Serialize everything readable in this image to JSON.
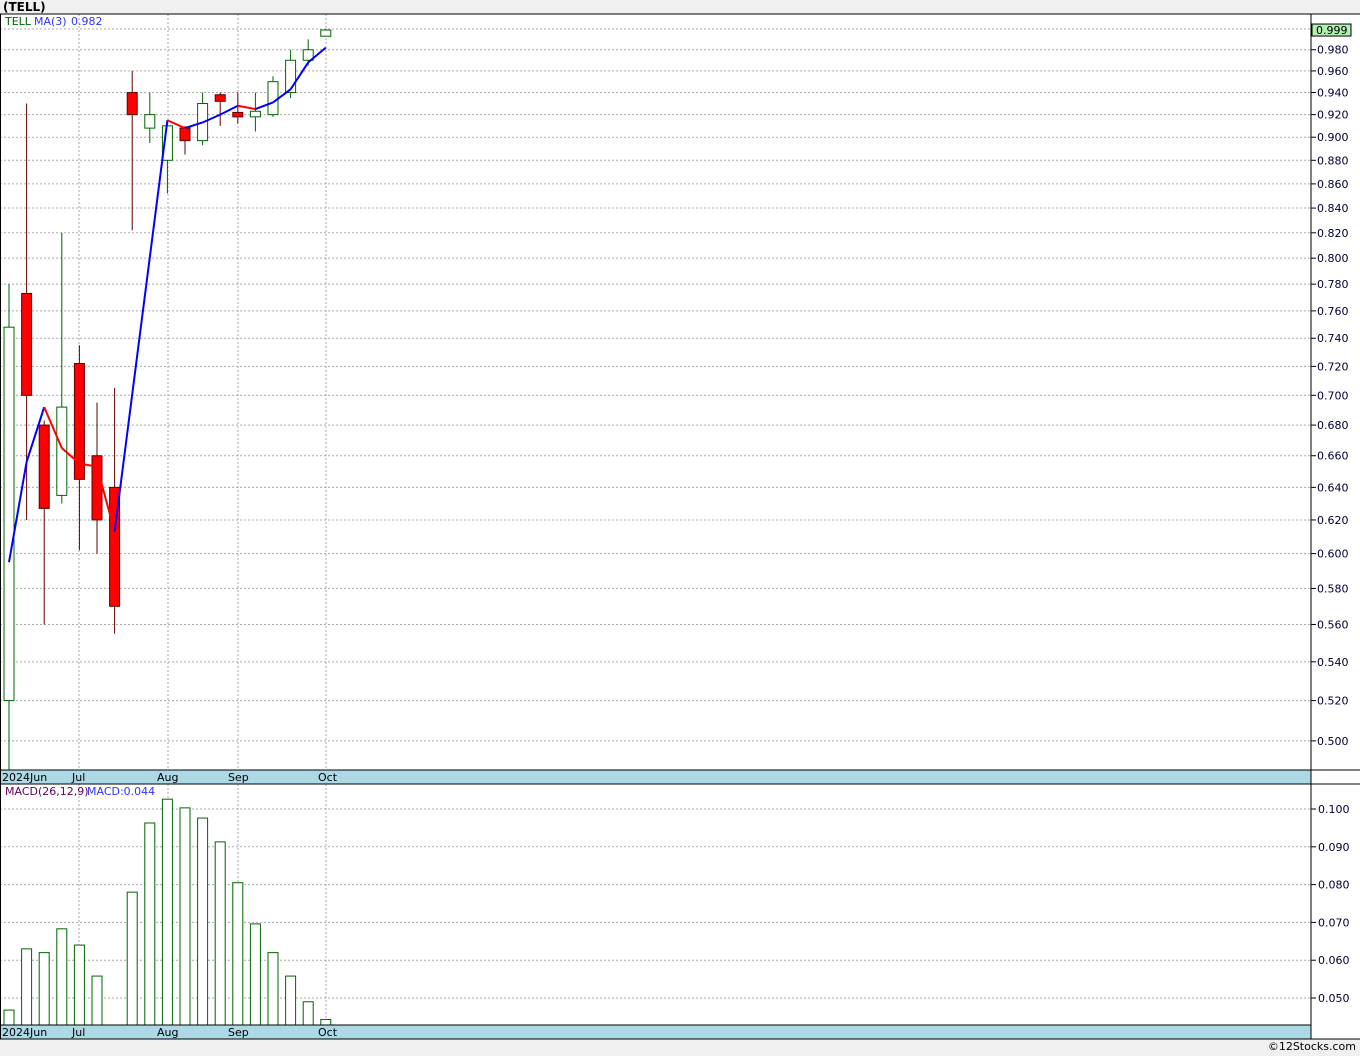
{
  "title": "(TELL)",
  "footer": "©12Stocks.com",
  "colors": {
    "up": "#006400",
    "down": "#ff0000",
    "down_wick": "#600000",
    "ma_up": "#0000ff",
    "ma_down": "#ff0000",
    "axis_bar": "#add8e6",
    "last_price_bg": "#b0f0b0"
  },
  "chart_data": [
    {
      "type": "candlestick",
      "legend": {
        "symbol": "TELL",
        "ma_label": "MA(3)",
        "ma_value": "0.982"
      },
      "y_scale": "log",
      "ylim": [
        0.48,
        1.0
      ],
      "y_ticks": [
        "1.000",
        "0.980",
        "0.960",
        "0.940",
        "0.920",
        "0.900",
        "0.880",
        "0.860",
        "0.840",
        "0.820",
        "0.800",
        "0.780",
        "0.760",
        "0.740",
        "0.720",
        "0.700",
        "0.680",
        "0.660",
        "0.640",
        "0.620",
        "0.600",
        "0.580",
        "0.560",
        "0.540",
        "0.520",
        "0.500"
      ],
      "last_price": "0.999",
      "x_ticks": [
        "2024Jun",
        "Jul",
        "Aug",
        "Sep",
        "Oct"
      ],
      "grid": true,
      "candles": [
        {
          "o": 0.52,
          "h": 0.78,
          "l": 0.48,
          "c": 0.748
        },
        {
          "o": 0.773,
          "h": 0.93,
          "l": 0.62,
          "c": 0.7
        },
        {
          "o": 0.68,
          "h": 0.683,
          "l": 0.56,
          "c": 0.627
        },
        {
          "o": 0.635,
          "h": 0.82,
          "l": 0.63,
          "c": 0.692
        },
        {
          "o": 0.722,
          "h": 0.735,
          "l": 0.602,
          "c": 0.645
        },
        {
          "o": 0.66,
          "h": 0.695,
          "l": 0.6,
          "c": 0.62
        },
        {
          "o": 0.64,
          "h": 0.705,
          "l": 0.555,
          "c": 0.57
        },
        {
          "o": 0.94,
          "h": 0.96,
          "l": 0.822,
          "c": 0.92
        },
        {
          "o": 0.908,
          "h": 0.94,
          "l": 0.895,
          "c": 0.92
        },
        {
          "o": 0.88,
          "h": 0.915,
          "l": 0.852,
          "c": 0.91
        },
        {
          "o": 0.908,
          "h": 0.91,
          "l": 0.885,
          "c": 0.897
        },
        {
          "o": 0.897,
          "h": 0.94,
          "l": 0.893,
          "c": 0.93
        },
        {
          "o": 0.938,
          "h": 0.94,
          "l": 0.91,
          "c": 0.932
        },
        {
          "o": 0.922,
          "h": 0.94,
          "l": 0.912,
          "c": 0.918
        },
        {
          "o": 0.918,
          "h": 0.94,
          "l": 0.905,
          "c": 0.923
        },
        {
          "o": 0.92,
          "h": 0.955,
          "l": 0.918,
          "c": 0.95
        },
        {
          "o": 0.94,
          "h": 0.98,
          "l": 0.935,
          "c": 0.97
        },
        {
          "o": 0.97,
          "h": 0.99,
          "l": 0.965,
          "c": 0.98
        },
        {
          "o": 0.993,
          "h": 1.0,
          "l": 0.993,
          "c": 0.999
        }
      ],
      "ma3": [
        0.595,
        0.656,
        0.692,
        0.665,
        0.655,
        0.653,
        0.613,
        null,
        null,
        0.915,
        0.908,
        0.913,
        0.92,
        0.928,
        0.925,
        0.931,
        0.943,
        0.968,
        0.982
      ]
    },
    {
      "type": "bar",
      "legend": {
        "label": "MACD(26,12,9)",
        "value": "MACD:0.044"
      },
      "ylim": [
        0.0429,
        0.1075
      ],
      "y_ticks": [
        "0.100",
        "0.090",
        "0.080",
        "0.070",
        "0.060",
        "0.050"
      ],
      "x_ticks": [
        "2024Jun",
        "Jul",
        "Aug",
        "Sep",
        "Oct"
      ],
      "grid": true,
      "values": [
        0.0468,
        0.063,
        0.062,
        0.0683,
        0.064,
        0.0558,
        null,
        0.078,
        0.0963,
        0.1026,
        0.1003,
        0.0976,
        0.0913,
        0.0805,
        0.0696,
        0.062,
        0.0558,
        0.049,
        0.0443
      ]
    }
  ]
}
